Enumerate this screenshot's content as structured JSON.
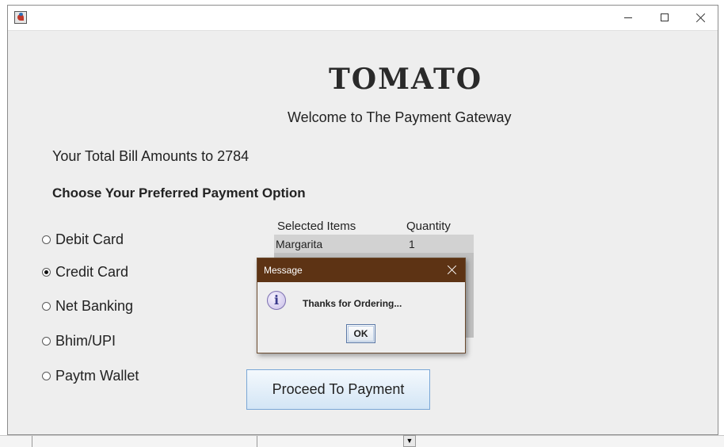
{
  "window": {
    "title": "",
    "controls": {
      "minimize": "minimize-icon",
      "maximize": "maximize-icon",
      "close": "close-icon"
    }
  },
  "brand": {
    "logo_text": "TOMATO"
  },
  "welcome_text": "Welcome to The Payment Gateway",
  "bill_text": "Your Total Bill Amounts to 2784",
  "choose_text": "Choose Your Preferred Payment Option",
  "payment_options": [
    {
      "label": "Debit Card",
      "selected": false
    },
    {
      "label": "Credit Card",
      "selected": true
    },
    {
      "label": "Net Banking",
      "selected": false
    },
    {
      "label": "Bhim/UPI",
      "selected": false
    },
    {
      "label": "Paytm Wallet",
      "selected": false
    }
  ],
  "items_table": {
    "headers": [
      "Selected Items",
      "Quantity"
    ],
    "rows": [
      [
        "Margarita",
        "1"
      ]
    ]
  },
  "proceed_label": "Proceed To Payment",
  "dialog": {
    "title": "Message",
    "message": "Thanks for Ordering...",
    "ok_label": "OK",
    "icon": "info-icon"
  },
  "colors": {
    "dialog_title_bg": "#5d3314",
    "window_bg": "#eeeeee",
    "button_border": "#7aa7d6"
  }
}
